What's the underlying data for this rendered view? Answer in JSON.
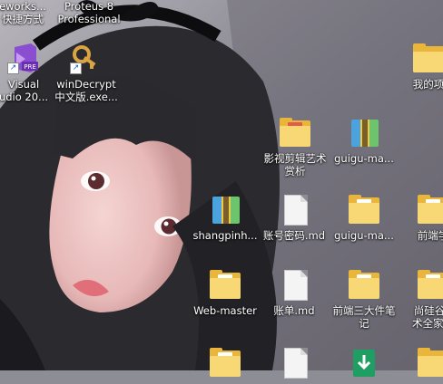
{
  "desktop": {
    "icons": [
      {
        "id": "labview",
        "label": "eworks...\n快捷方式",
        "kind": "app"
      },
      {
        "id": "proteus",
        "label": "Proteus 8\nProfessional",
        "kind": "app"
      },
      {
        "id": "visual-studio",
        "label": "Visual\nudio 20...",
        "kind": "app"
      },
      {
        "id": "windecrypt",
        "label": "winDecrypt\n中文版.exe...",
        "kind": "app"
      },
      {
        "id": "my-projects",
        "label": "我的项",
        "kind": "folder"
      },
      {
        "id": "video-editing",
        "label": "影视剪辑艺术\n赏析",
        "kind": "folder"
      },
      {
        "id": "guigu-1",
        "label": "guigu-ma...",
        "kind": "zip"
      },
      {
        "id": "shangpinh",
        "label": "shangpinh...",
        "kind": "zip"
      },
      {
        "id": "account-password",
        "label": "账号密码.md",
        "kind": "doc"
      },
      {
        "id": "guigu-2",
        "label": "guigu-ma...",
        "kind": "folder"
      },
      {
        "id": "frontend-study",
        "label": "前端学",
        "kind": "folder"
      },
      {
        "id": "web-master",
        "label": "Web-master",
        "kind": "folder"
      },
      {
        "id": "bill",
        "label": "账单.md",
        "kind": "doc"
      },
      {
        "id": "frontend-notes",
        "label": "前端三大件笔\n记",
        "kind": "folder"
      },
      {
        "id": "shangguigu",
        "label": "尚硅谷V\n术全家桶",
        "kind": "folder"
      }
    ]
  }
}
